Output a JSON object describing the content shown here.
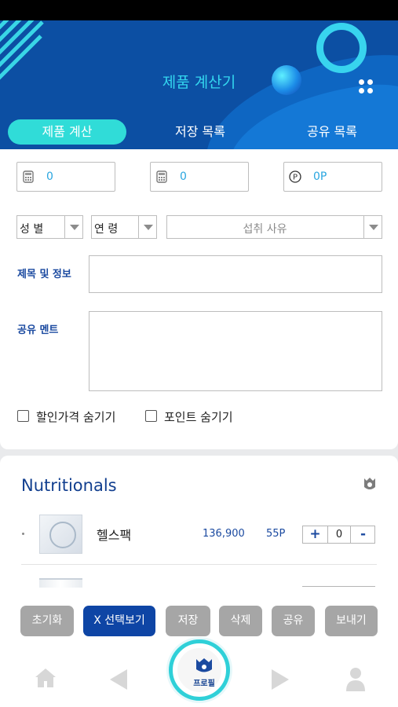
{
  "header": {
    "title": "제품 계산기",
    "tabs": [
      {
        "label": "제품 계산",
        "active": true
      },
      {
        "label": "저장 목록",
        "active": false
      },
      {
        "label": "공유 목록",
        "active": false
      }
    ]
  },
  "form": {
    "totals": [
      {
        "icon": "calculator-icon",
        "value": "0"
      },
      {
        "icon": "calculator-icon",
        "value": "0"
      },
      {
        "icon": "points-icon",
        "value": "0P"
      }
    ],
    "gender_select": "성 별",
    "age_select": "연 령",
    "reason_select_placeholder": "섭취 사유",
    "title_label": "제목 및 정보",
    "title_value": "",
    "comment_label": "공유 멘트",
    "comment_value": "",
    "hide_discount_label": "할인가격 숨기기",
    "hide_points_label": "포인트 숨기기"
  },
  "products": {
    "section_title": "Nutritionals",
    "items": [
      {
        "name": "헬스팩",
        "price": "136,900",
        "points": "55P",
        "qty": "0",
        "plus": "+",
        "minus": "-"
      }
    ]
  },
  "actions": {
    "reset": "초기화",
    "view_selected": "X 선택보기",
    "save": "저장",
    "delete": "삭제",
    "share": "공유",
    "send": "보내기"
  },
  "bottom_nav": {
    "profile_label": "프로필"
  },
  "colors": {
    "header_bg": "#0c4fa3",
    "accent_cyan": "#30dcd8",
    "primary_button": "#0e45a5",
    "text_blue": "#1b4aa0"
  }
}
